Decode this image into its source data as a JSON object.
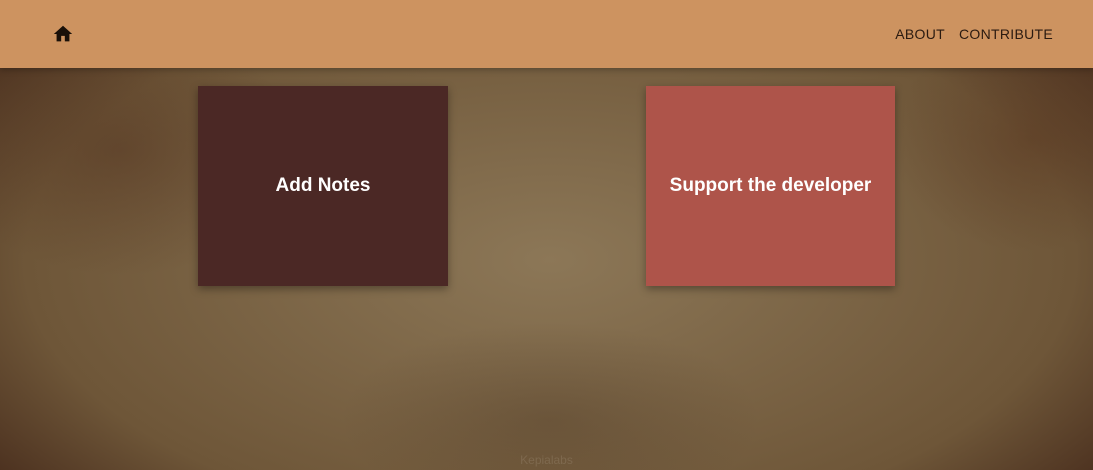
{
  "header": {
    "home_icon": "home-icon",
    "nav": [
      {
        "label": "ABOUT"
      },
      {
        "label": "CONTRIBUTE"
      }
    ]
  },
  "cards": {
    "add_notes": {
      "label": "Add Notes",
      "color": "#4b2825"
    },
    "support": {
      "label": "Support the developer",
      "color": "#ae544a"
    }
  },
  "footer": {
    "text": "Kepialabs"
  },
  "colors": {
    "navbar": "#cd9360",
    "background": "#7d6648"
  }
}
